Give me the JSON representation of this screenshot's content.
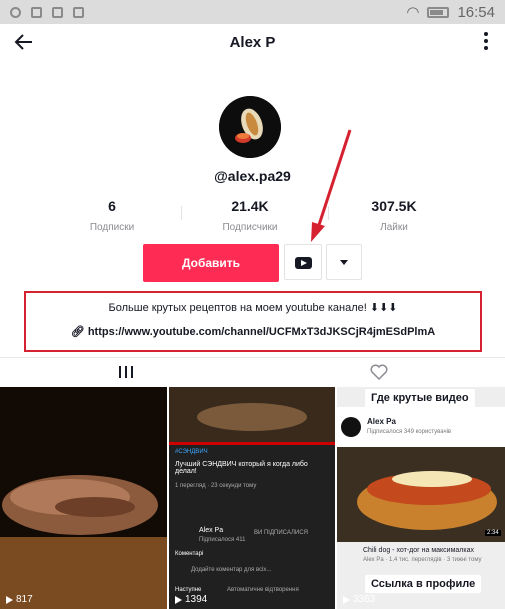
{
  "status_bar": {
    "time": "16:54"
  },
  "header": {
    "title": "Alex P"
  },
  "profile": {
    "username": "@alex.pa29"
  },
  "stats": [
    {
      "value": "6",
      "label": "Подписки"
    },
    {
      "value": "21.4K",
      "label": "Подписчики"
    },
    {
      "value": "307.5K",
      "label": "Лайки"
    }
  ],
  "actions": {
    "follow_label": "Добавить"
  },
  "bio": {
    "text": "Больше крутых рецептов на моем youtube канале! ⬇︎⬇︎⬇︎",
    "link": "https://www.youtube.com/channel/UCFMxT3dJKSCjR4jmESdPlmA"
  },
  "videos": [
    {
      "views": "817"
    },
    {
      "views": "1394",
      "overlay": {
        "hashtag": "#СЭНДВИЧ",
        "title": "Лучший СЭНДВИЧ который я когда либо делал!",
        "meta": "1 перегляд · 23 секунди тому",
        "channel": "Alex Pa",
        "subs": "Підписалося 411",
        "subscribed": "ВИ ПІДПИСАЛИСЯ",
        "comments_label": "Коментарі",
        "comment_placeholder": "Додайте коментар для всіх...",
        "next_label": "Наступне",
        "autoplay_label": "Автоматичне відтворення"
      }
    },
    {
      "views": "3363",
      "overlay": {
        "bubble_top": "Где крутые видео",
        "channel": "Alex Pa",
        "subs": "Підписалося 349 користувачів",
        "video_title": "Chili dog - хот-дог на максималках",
        "meta": "Alex Pa · 1,4 тис. переглядів · 3 тижні тому",
        "duration": "2:34",
        "bubble_bottom": "Ссылка в профиле"
      }
    }
  ],
  "colors": {
    "accent": "#fe2c55",
    "highlight": "#d62131"
  }
}
